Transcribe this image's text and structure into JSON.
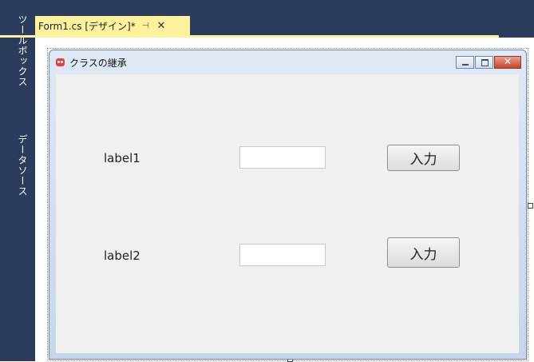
{
  "side_panel": {
    "toolbox_label": "ツールボックス",
    "datasource_label": "データソース"
  },
  "document_tab": {
    "title": "Form1.cs [デザイン]*",
    "pin_icon": "pin-icon",
    "close_icon": "close-icon"
  },
  "form": {
    "title": "クラスの継承",
    "icon": "app-icon",
    "caption_buttons": [
      "minimize",
      "maximize",
      "close"
    ]
  },
  "controls": {
    "label1": "label1",
    "label2": "label2",
    "button1": "入力",
    "button2": "入力",
    "textbox1_value": "",
    "textbox2_value": ""
  },
  "colors": {
    "ide_background": "#2b3c5d",
    "active_tab": "#fff29d",
    "form_client": "#f0f0f0"
  }
}
